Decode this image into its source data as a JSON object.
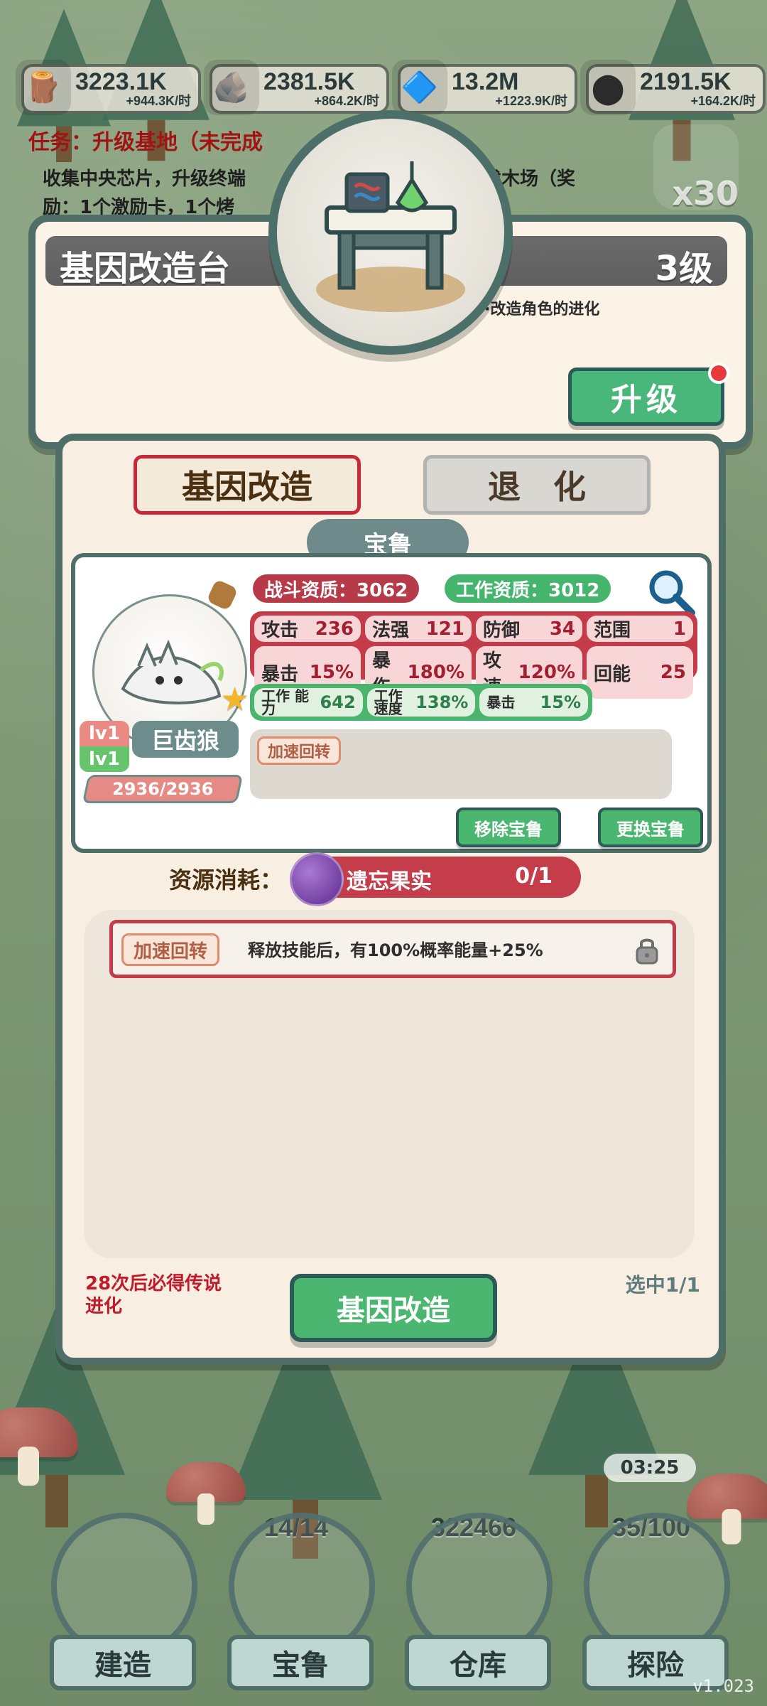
{
  "resources": [
    {
      "icon": "wood-icon",
      "value": "3223.1K",
      "rate": "+944.3K/时"
    },
    {
      "icon": "stone-icon",
      "value": "2381.5K",
      "rate": "+864.2K/时"
    },
    {
      "icon": "crystal-icon",
      "value": "13.2M",
      "rate": "+1223.9K/时"
    },
    {
      "icon": "coal-icon",
      "value": "2191.5K",
      "rate": "+164.2K/时"
    }
  ],
  "task": {
    "title": "任务：升级基地（未完成",
    "line2": "收集中央芯片，升级终端",
    "line3": "励：1个激励卡，1个烤",
    "line_right": "伐木场（奖"
  },
  "side": {
    "multiplier": "x30"
  },
  "building": {
    "title": "基因改造台",
    "level": "3级",
    "desc": "·改造角色的进化",
    "upgrade_label": "升级"
  },
  "tabs": {
    "active": "基因改造",
    "inactive": "退　化"
  },
  "pet": {
    "section_label": "宝鲁",
    "fight_quality": "战斗资质：3062",
    "work_quality": "工作资质：3012",
    "lv_a": "lv1",
    "lv_b": "lv1",
    "name": "巨齿狼",
    "hp": "2936/2936",
    "stats_red": [
      {
        "label": "攻击",
        "value": "236"
      },
      {
        "label": "法强",
        "value": "121"
      },
      {
        "label": "防御",
        "value": "34"
      },
      {
        "label": "范围",
        "value": "1"
      },
      {
        "label": "暴击",
        "value": "15%"
      },
      {
        "label": "暴伤",
        "value": "180%"
      },
      {
        "label": "攻速",
        "value": "120%"
      },
      {
        "label": "回能",
        "value": "25"
      }
    ],
    "stats_green": [
      {
        "label": "工作\n能力",
        "value": "642"
      },
      {
        "label": "工作\n速度",
        "value": "138%"
      },
      {
        "label": "暴击",
        "value": "15%"
      }
    ],
    "skill_tag": "加速回转",
    "remove_label": "移除宝鲁",
    "replace_label": "更换宝鲁"
  },
  "consume": {
    "label": "资源消耗：",
    "item": "遗忘果实",
    "count": "0/1"
  },
  "effect": {
    "tag": "加速回转",
    "text": "释放技能后，有100%概率能量+25%"
  },
  "footer": {
    "guarantee": "28次后必得传说\n进化",
    "selected": "选中1/1",
    "main_label": "基因改造"
  },
  "nav": [
    {
      "label": "建造",
      "top": ""
    },
    {
      "label": "宝鲁",
      "top": "14/14"
    },
    {
      "label": "仓库",
      "top": "322466"
    },
    {
      "label": "探险",
      "top": "35/100"
    }
  ],
  "timer": "03:25",
  "version": "v1.023"
}
